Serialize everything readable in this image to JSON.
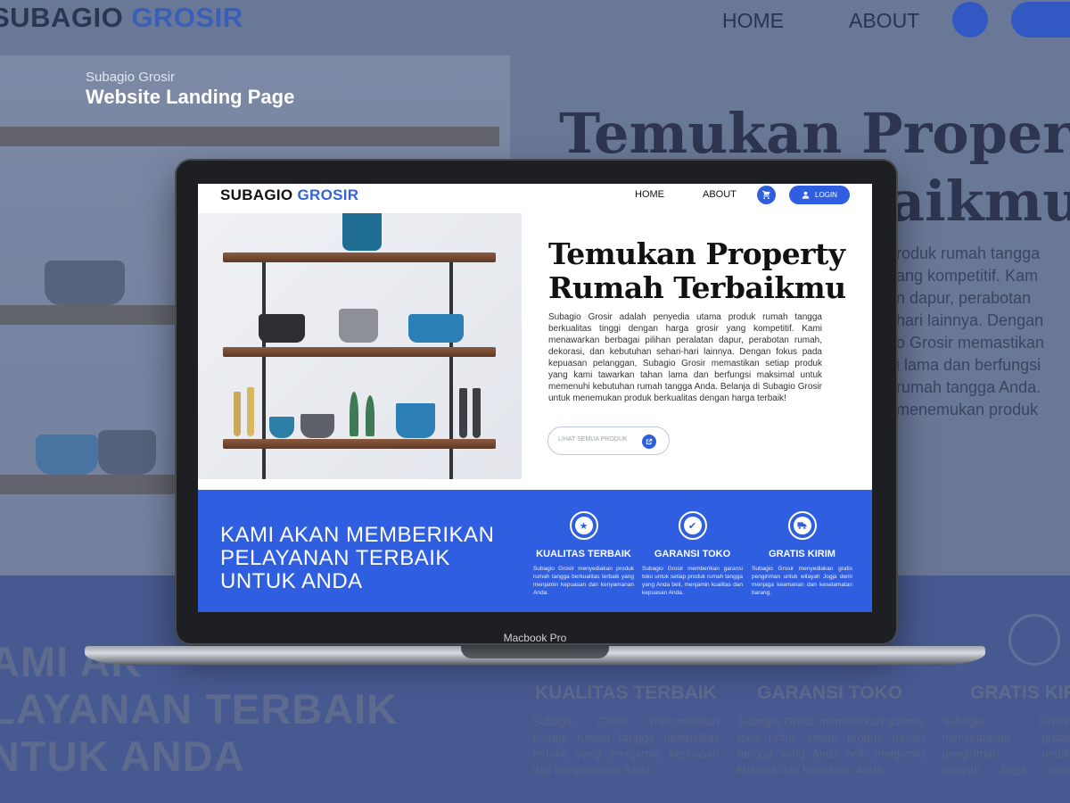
{
  "caption": {
    "subtitle": "Subagio Grosir",
    "title": "Website Landing Page"
  },
  "device": {
    "label": "Macbook Pro"
  },
  "site": {
    "brand_primary": "SUBAGIO",
    "brand_accent": "GROSIR",
    "nav": {
      "home": "HOME",
      "about": "ABOUT",
      "login": "LOGIN"
    },
    "hero": {
      "title_line1": "Temukan Property",
      "title_line2": "Rumah Terbaikmu",
      "text": "Subagio Grosir adalah penyedia utama produk rumah tangga berkualitas tinggi dengan harga grosir yang kompetitif. Kami menawarkan berbagai pilihan peralatan dapur, perabotan rumah, dekorasi, dan kebutuhan sehari-hari lainnya. Dengan fokus pada kepuasan pelanggan, Subagio Grosir memastikan setiap produk yang kami tawarkan tahan lama dan berfungsi maksimal untuk memenuhi kebutuhan rumah tangga Anda. Belanja di Subagio Grosir untuk menemukan produk berkualitas dengan harga terbaik!",
      "cta_label": "LIHAT SEMUA PRODUK"
    },
    "band": {
      "title_line1": "KAMI AKAN MEMBERIKAN",
      "title_line2": "PELAYANAN TERBAIK",
      "title_line3": "UNTUK ANDA"
    },
    "features": [
      {
        "icon": "star-icon",
        "title": "KUALITAS TERBAIK",
        "text": "Subagio Grosir menyediakan produk rumah tangga berkualitas terbaik yang menjamin kepuasan dan kenyamanan Anda."
      },
      {
        "icon": "check-icon",
        "title": "GARANSI TOKO",
        "text": "Subagio Grosir memberikan garansi toko untuk setiap produk rumah tangga yang Anda beli, menjamin kualitas dan kepuasan Anda."
      },
      {
        "icon": "truck-icon",
        "title": "GRATIS KIRIM",
        "text": "Subagio Grosir menyediakan gratis pengiriman untuk wilayah Jogja demi menjaga keamanan dan keselamatan barang."
      }
    ]
  },
  "background": {
    "hero_line1": "Temukan Property",
    "hero_line2": "aikmu",
    "paragraph_lines": [
      "roduk rumah tangga",
      "ang kompetitif. Kam",
      "n dapur, perabotan",
      "hari lainnya. Dengan",
      "o Grosir memastikan",
      "i lama dan berfungsi",
      "rumah tangga Anda.",
      "menemukan produk"
    ],
    "big_line1": "AMI AK",
    "big_line2": "LAYANAN TERBAIK",
    "big_line3": "NTUK ANDA"
  },
  "colors": {
    "accent": "#2f5fe0",
    "frame": "#1d1f22"
  }
}
